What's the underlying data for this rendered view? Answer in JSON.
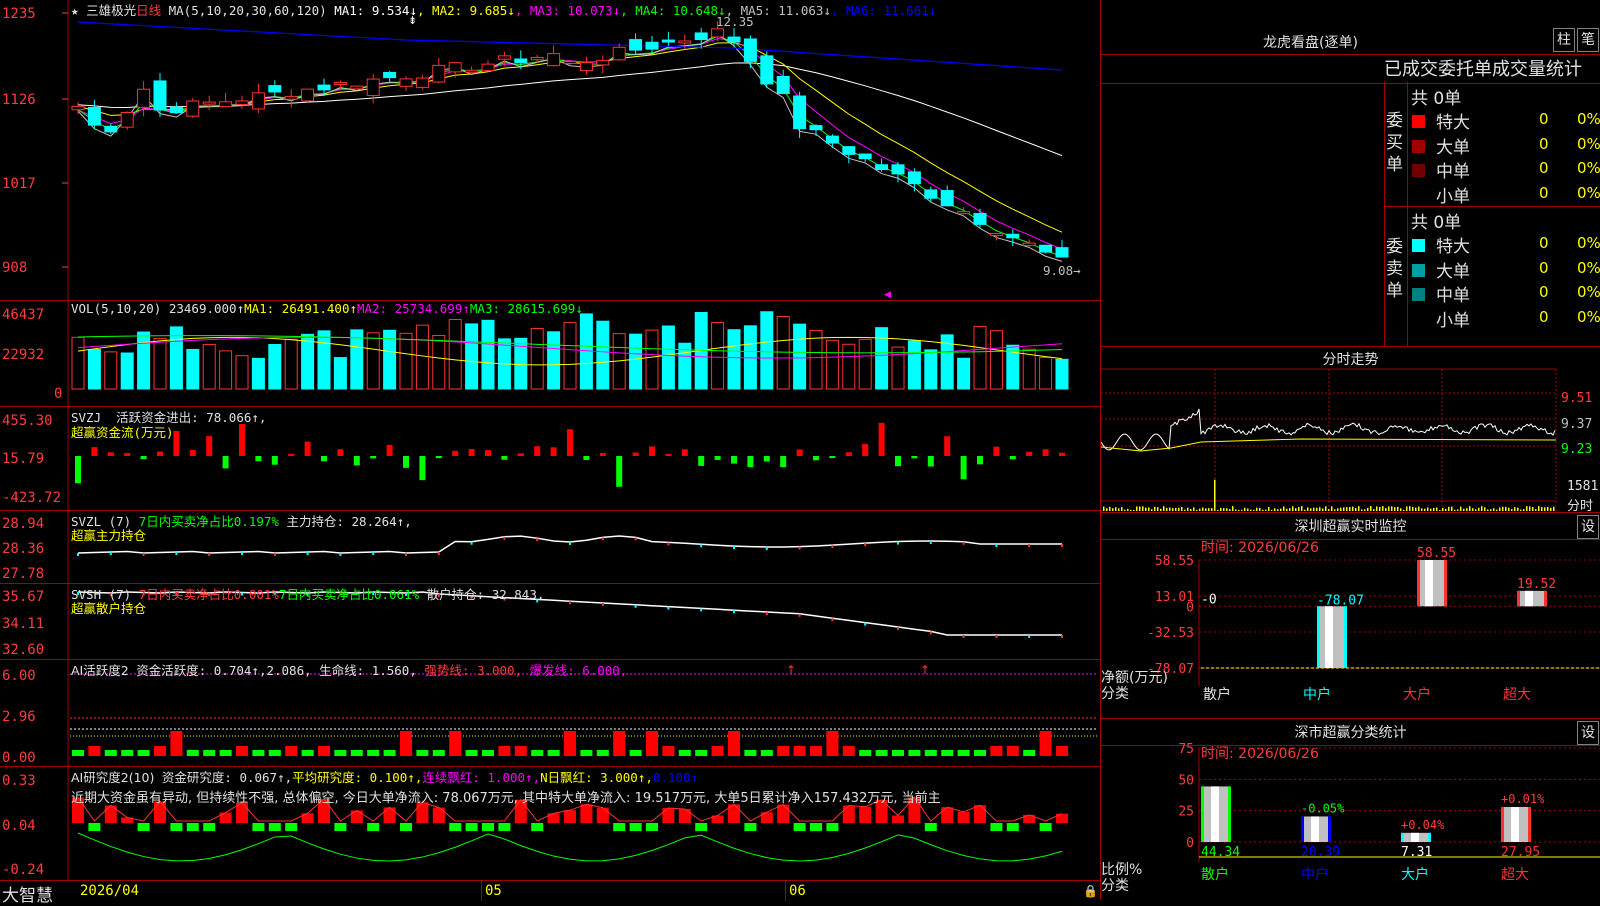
{
  "stock": {
    "star": "★",
    "name": "三雄极光",
    "period": "日线"
  },
  "price": {
    "ma_label": "MA(5,10,20,30,60,120)",
    "ma": [
      {
        "t": "MA1: 9.534↓",
        "c": "#ffffff"
      },
      {
        "t": "MA2: 9.685↓",
        "c": "#ffff00"
      },
      {
        "t": "MA3: 10.073↓",
        "c": "#ff00ff"
      },
      {
        "t": "MA4: 10.648↓",
        "c": "#00ff00"
      },
      {
        "t": "MA5: 11.063↓",
        "c": "#c0c0c0"
      },
      {
        "t": "MA6: 11.661↓",
        "c": "#0000ff"
      }
    ],
    "ylabels": [
      "1235",
      "1126",
      "1017",
      "908"
    ],
    "high_label": "12.35",
    "low_label": "9.08→"
  },
  "vol": {
    "title": "VOL(5,10,20)",
    "v": "23469.000↑",
    "ma1": "MA1: 26491.400↑",
    "ma2": "MA2: 25734.699↑",
    "ma3": "MA3: 28615.699↓",
    "ylabels": [
      "46437",
      "22932",
      "0"
    ]
  },
  "svzj": {
    "title": "SVZJ",
    "t1": "活跃资金进出: 78.066↑,",
    "t2": "超赢资金流(万元)",
    "ylabels": [
      "455.30",
      "15.79",
      "-423.72"
    ]
  },
  "svzl": {
    "title": "SVZL (7)",
    "t1": "7日内买卖净占比0.197%",
    "t2": "主力持仓: 28.264↑,",
    "t3": "超赢主力持仓",
    "ylabels": [
      "28.94",
      "28.36",
      "27.78"
    ]
  },
  "svsh": {
    "title": "SVSH (7)",
    "t1": "7日内买卖净占比0.001%",
    "t2": "7日内买卖净占比0.061%",
    "t3": "散户持仓: 32.843,",
    "t4": "超赢散户持仓",
    "ylabels": [
      "35.67",
      "34.11",
      "32.60"
    ]
  },
  "ai1": {
    "title": "AI活跃度2",
    "t1": "资金活跃度: 0.704↑,",
    "t2": "2.086,",
    "t3": "生命线: 1.560,",
    "t4": "强势线: 3.000,",
    "t5": "爆发线: 6.000,",
    "ylabels": [
      "6.00",
      "2.96",
      "0.00"
    ]
  },
  "ai2": {
    "title": "AI研究度2(10)",
    "t1": "资金研究度: 0.067↑,",
    "t2": "平均研究度: 0.100↑,",
    "t3": "连续飘红: 1.000↑,",
    "t4": "N日飘红: 3.000↑,",
    "t5": "0.100↑",
    "note": "近期大资金虽有异动, 但持续性不强, 总体偏空, 今日大单净流入: 78.067万元, 其中特大单净流入: 19.517万元, 大单5日累计净入157.432万元, 当前主",
    "ylabels": [
      "0.33",
      "0.04",
      "-0.24"
    ]
  },
  "footer": {
    "brand": "大智慧",
    "d1": "2026/04",
    "d2": "05",
    "d3": "06"
  },
  "longhu": {
    "title": "龙虎看盘(逐单)",
    "btn1": "柱",
    "btn2": "笔",
    "heading": "已成交委托单成交量统计",
    "buy": {
      "side": "委买单",
      "total": "共 0单",
      "rows": [
        {
          "label": "特大",
          "c": "#ff0000",
          "v": "0",
          "p": "0%"
        },
        {
          "label": "大单",
          "c": "#a00000",
          "v": "0",
          "p": "0%"
        },
        {
          "label": "中单",
          "c": "#700000",
          "v": "0",
          "p": "0%"
        },
        {
          "label": "小单",
          "c": "#000000",
          "v": "0",
          "p": "0%"
        }
      ]
    },
    "sell": {
      "side": "委卖单",
      "total": "共 0单",
      "rows": [
        {
          "label": "特大",
          "c": "#00ffff",
          "v": "0",
          "p": "0%"
        },
        {
          "label": "大单",
          "c": "#00a0a0",
          "v": "0",
          "p": "0%"
        },
        {
          "label": "中单",
          "c": "#008080",
          "v": "0",
          "p": "0%"
        },
        {
          "label": "小单",
          "c": "#000000",
          "v": "0",
          "p": "0%"
        }
      ]
    }
  },
  "intraday": {
    "title": "分时走势",
    "ylabels": [
      "9.51",
      "9.37",
      "9.23"
    ],
    "vol_label": "1581",
    "vol_unit": "分时"
  },
  "monitor": {
    "title": "深圳超赢实时监控",
    "btn": "设",
    "time": "时间: 2026/06/26",
    "ylabels": [
      "58.55",
      "13.01",
      "0",
      "-32.53",
      "-78.07"
    ],
    "ylabel_name": "净额(万元)",
    "xlabel_name": "分类",
    "cats": [
      "散户",
      "中户",
      "大户",
      "超大"
    ],
    "values": [
      0,
      -78.07,
      58.55,
      19.52
    ],
    "value_labels": [
      "-0",
      "-78.07",
      "58.55",
      "19.52"
    ]
  },
  "classify": {
    "title": "深市超赢分类统计",
    "btn": "设",
    "time": "时间: 2026/06/26",
    "ylabels": [
      "75",
      "50",
      "25",
      "0"
    ],
    "ylabel_name": "比例%",
    "xlabel_name": "分类",
    "cats": [
      "散户",
      "中户",
      "大户",
      "超大"
    ],
    "values": [
      44.34,
      20.39,
      7.31,
      27.95
    ],
    "value_labels": [
      "44.34",
      "20.39",
      "7.31",
      "27.95"
    ],
    "change_labels": [
      "",
      "-0.05%",
      "+0.04%",
      "+0.01%"
    ]
  },
  "chart_data": [
    {
      "type": "candlestick",
      "title": "三雄极光 日线",
      "series": "price",
      "ylim": [
        9.0,
        12.4
      ],
      "ma_values": {
        "MA1": 9.534,
        "MA2": 9.685,
        "MA3": 10.073,
        "MA4": 10.648,
        "MA5": 11.063,
        "MA6": 11.661
      },
      "high": 12.35,
      "low": 9.08
    },
    {
      "type": "bar",
      "title": "VOL(5,10,20)",
      "ylim": [
        0,
        46437
      ],
      "last": 23469.0,
      "MA1": 26491.4,
      "MA2": 25734.699,
      "MA3": 28615.699
    },
    {
      "type": "bar",
      "title": "SVZJ",
      "ylim": [
        -423.72,
        455.3
      ],
      "last": 78.066
    },
    {
      "type": "bar",
      "title": "深圳超赢实时监控",
      "categories": [
        "散户",
        "中户",
        "大户",
        "超大"
      ],
      "values": [
        0,
        -78.07,
        58.55,
        19.52
      ],
      "ylim": [
        -78.07,
        58.55
      ]
    },
    {
      "type": "bar",
      "title": "深市超赢分类统计",
      "categories": [
        "散户",
        "中户",
        "大户",
        "超大"
      ],
      "values": [
        44.34,
        20.39,
        7.31,
        27.95
      ],
      "ylim": [
        0,
        75
      ]
    }
  ]
}
